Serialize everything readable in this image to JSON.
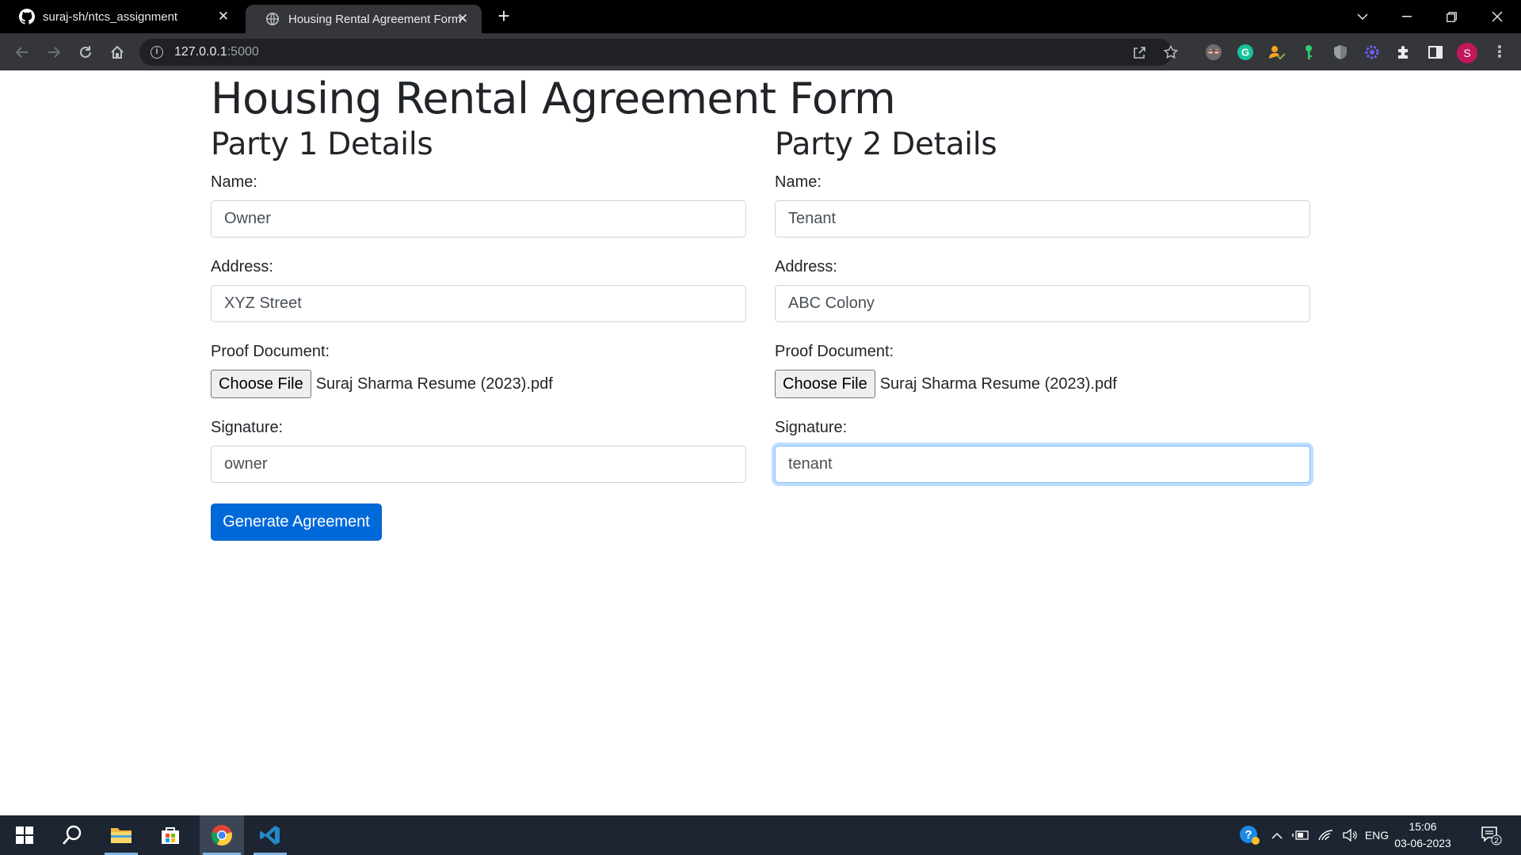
{
  "browser": {
    "tabs": [
      {
        "title": "suraj-sh/ntcs_assignment",
        "icon": "github-icon",
        "active": false
      },
      {
        "title": "Housing Rental Agreement Form",
        "icon": "globe-icon",
        "active": true
      }
    ],
    "url_host": "127.0.0.1",
    "url_port": ":5000",
    "profile_initial": "S"
  },
  "page": {
    "title": "Housing Rental Agreement Form",
    "parties": [
      {
        "heading": "Party 1 Details",
        "name_label": "Name:",
        "name_value": "Owner",
        "address_label": "Address:",
        "address_value": "XYZ Street",
        "proof_label": "Proof Document:",
        "file_button": "Choose File",
        "file_name": "Suraj Sharma Resume (2023).pdf",
        "signature_label": "Signature:",
        "signature_value": "owner"
      },
      {
        "heading": "Party 2 Details",
        "name_label": "Name:",
        "name_value": "Tenant",
        "address_label": "Address:",
        "address_value": "ABC Colony",
        "proof_label": "Proof Document:",
        "file_button": "Choose File",
        "file_name": "Suraj Sharma Resume (2023).pdf",
        "signature_label": "Signature:",
        "signature_value": "tenant"
      }
    ],
    "submit_label": "Generate Agreement"
  },
  "taskbar": {
    "language": "ENG",
    "time": "15:06",
    "date": "03-06-2023",
    "notification_count": "2"
  },
  "colors": {
    "primary_button": "#0069d9",
    "focus_ring": "#80bdff",
    "taskbar": "#1c2531",
    "toolbar": "#35363a"
  }
}
